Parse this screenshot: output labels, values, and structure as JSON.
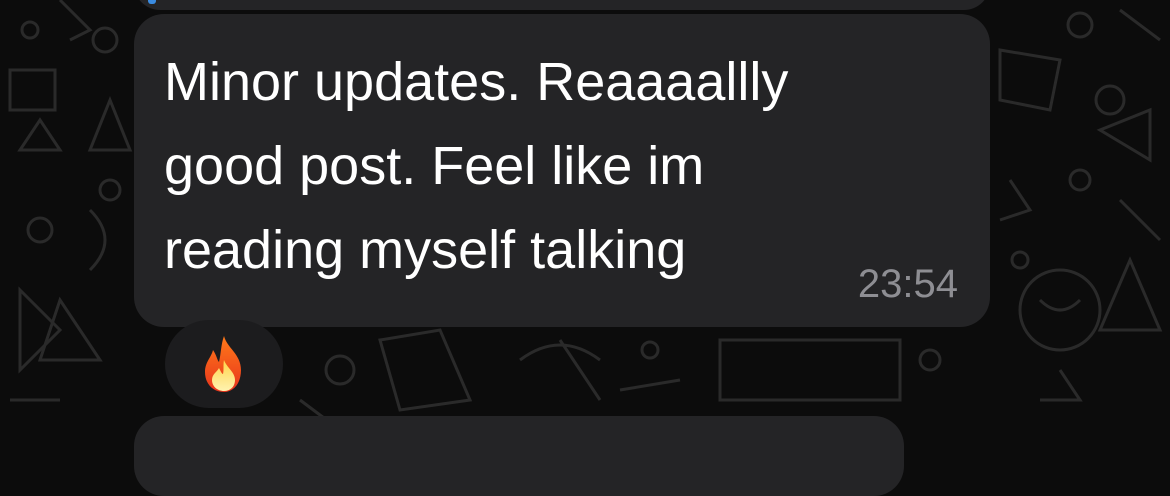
{
  "message": {
    "text": "Minor updates. Reaaaallly\ngood post. Feel like im\nreading myself talking",
    "time": "23:54"
  },
  "reaction": {
    "icon": "fire-emoji-icon"
  },
  "colors": {
    "background": "#0c0c0c",
    "bubble": "#242426",
    "text": "#ffffff",
    "timestamp": "#8e8e93",
    "reply_accent": "#3a8be0"
  }
}
